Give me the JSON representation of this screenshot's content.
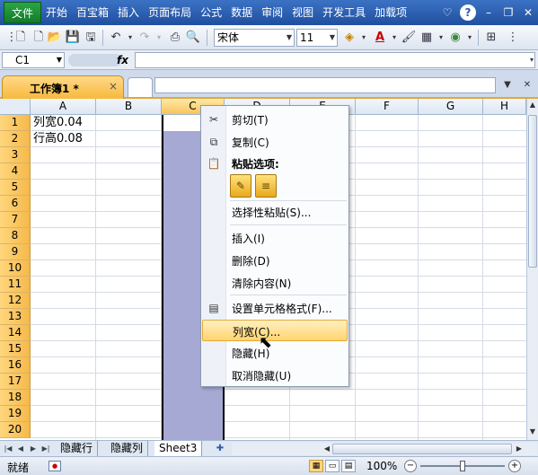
{
  "menubar": {
    "file_label": "文件",
    "items": [
      "开始",
      "百宝箱",
      "插入",
      "页面布局",
      "公式",
      "数据",
      "审阅",
      "视图",
      "开发工具",
      "加载项"
    ],
    "help_icon": "question-icon"
  },
  "toolbar": {
    "font_name": "宋体",
    "font_size": "11"
  },
  "formula_bar": {
    "cell_ref": "C1",
    "fx_label": "fx",
    "value": ""
  },
  "doc_tab": {
    "title": "工作簿1 *",
    "close": "×"
  },
  "grid": {
    "columns": [
      "A",
      "B",
      "C",
      "D",
      "E",
      "F",
      "G",
      "H"
    ],
    "selected_column": "C",
    "rows": [
      "1",
      "2",
      "3",
      "4",
      "5",
      "6",
      "7",
      "8",
      "9",
      "10",
      "11",
      "12",
      "13",
      "14",
      "15",
      "16",
      "17",
      "18",
      "19",
      "20"
    ],
    "cells": {
      "A1": "列宽0.04",
      "A2": "行高0.08"
    }
  },
  "context_menu": {
    "items": [
      {
        "label": "剪切(T)",
        "icon": "scissors-icon"
      },
      {
        "label": "复制(C)",
        "icon": "copy-icon"
      },
      {
        "label": "粘贴选项:",
        "icon": "paste-icon"
      },
      {
        "label": "选择性粘贴(S)...",
        "icon": ""
      },
      {
        "label": "插入(I)",
        "icon": ""
      },
      {
        "label": "删除(D)",
        "icon": ""
      },
      {
        "label": "清除内容(N)",
        "icon": ""
      },
      {
        "label": "设置单元格格式(F)...",
        "icon": "format-cells-icon"
      },
      {
        "label": "列宽(C)...",
        "icon": ""
      },
      {
        "label": "隐藏(H)",
        "icon": ""
      },
      {
        "label": "取消隐藏(U)",
        "icon": ""
      }
    ],
    "highlighted": "列宽(C)...",
    "highlight_color": "#ffd46e"
  },
  "sheets": {
    "tabs": [
      "隐藏行",
      "隐藏列",
      "Sheet3"
    ],
    "active": "Sheet3"
  },
  "statusbar": {
    "status": "就绪",
    "zoom": "100%"
  },
  "colors": {
    "menubar": "#2a5db0",
    "row_header": "#f5b94a",
    "column_selection": "#a6a9d4"
  }
}
